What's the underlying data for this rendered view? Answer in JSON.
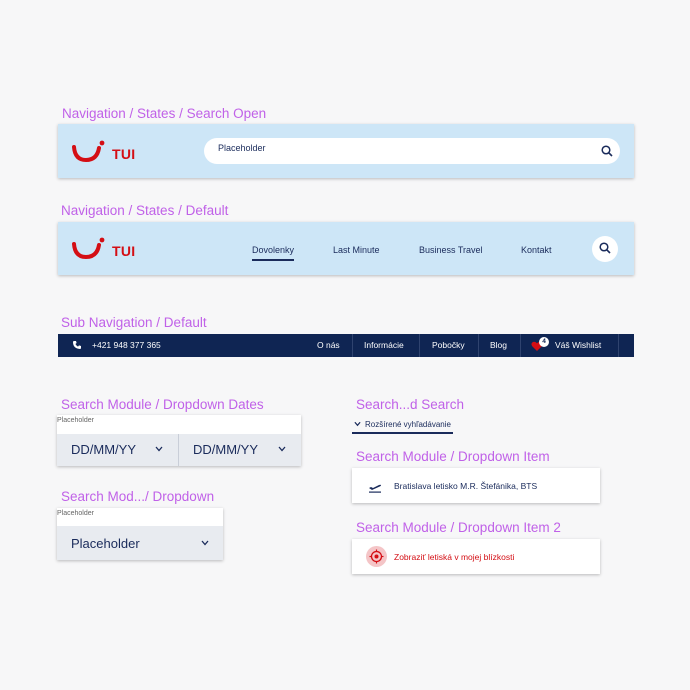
{
  "labels": {
    "nav_search_open": "Navigation / States / Search Open",
    "nav_default": "Navigation / States / Default",
    "sub_nav": "Sub Navigation / Default",
    "dropdown_dates": "Search Module / Dropdown Dates",
    "dropdown": "Search Mod.../ Dropdown",
    "advanced_search": "Search...d Search",
    "dropdown_item": "Search Module / Dropdown Item",
    "dropdown_item_2": "Search Module / Dropdown Item 2"
  },
  "brand": {
    "name": "TUI",
    "logo_color": "#d40e14"
  },
  "nav_search": {
    "placeholder": "Placeholder"
  },
  "nav_default": {
    "menu": [
      "Dovolenky",
      "Last Minute",
      "Business Travel",
      "Kontakt"
    ],
    "active_index": 0
  },
  "sub_nav": {
    "phone": "+421 948 377 365",
    "items": [
      "O nás",
      "Informácie",
      "Pobočky",
      "Blog"
    ],
    "wishlist_label": "Váš Wishlist",
    "wishlist_count": "4"
  },
  "dropdown_dates": {
    "label": "Placeholder",
    "from": "DD/MM/YY",
    "to": "DD/MM/YY"
  },
  "dropdown": {
    "label": "Placeholder",
    "value": "Placeholder"
  },
  "advanced_search": {
    "label": "Rozšírené vyhľadávanie"
  },
  "dropdown_item": {
    "text": "Bratislava letisko M.R. Štefánika, BTS"
  },
  "dropdown_item_2": {
    "text": "Zobraziť letiská v mojej blízkosti",
    "color": "#d40e14"
  },
  "colors": {
    "navy": "#0f2553",
    "light_blue": "#cde6f7",
    "label_purple": "#c061e8"
  },
  "icons": [
    "search-icon",
    "phone-icon",
    "heart-icon",
    "chevron-down-icon",
    "plane-departure-icon",
    "location-target-icon"
  ]
}
